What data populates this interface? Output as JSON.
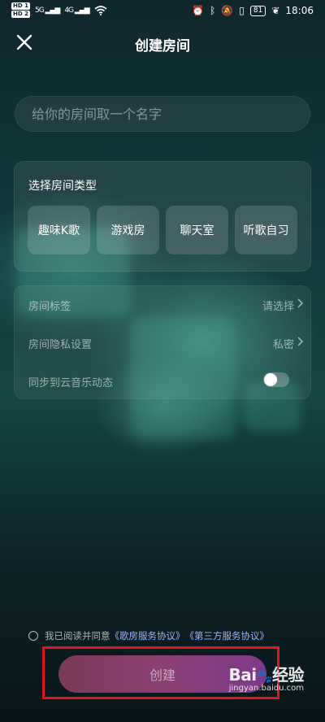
{
  "status_bar": {
    "hd1": "HD 1",
    "hd2": "HD 2",
    "sig1": "5G",
    "sig2": "4G",
    "battery": "81",
    "time": "18:06"
  },
  "header": {
    "title": "创建房间"
  },
  "name_input": {
    "placeholder": "给你的房间取一个名字",
    "value": ""
  },
  "room_type": {
    "title": "选择房间类型",
    "options": [
      "趣味K歌",
      "游戏房",
      "聊天室",
      "听歌自习"
    ]
  },
  "settings": {
    "tag_label": "房间标签",
    "tag_value": "请选择",
    "privacy_label": "房间隐私设置",
    "privacy_value": "私密",
    "sync_label": "同步到云音乐动态",
    "sync_on": false
  },
  "agreement": {
    "prefix": "我已阅读并同意",
    "link1": "《歌房服务协议》",
    "link2": "《第三方服务协议》"
  },
  "create_button": {
    "label": "创建"
  },
  "watermark": {
    "brand": "Bai",
    "brand_suffix": "经验",
    "url": "jingyan.baidu.com"
  },
  "colors": {
    "highlight": "#e0161d",
    "link": "#9fb3ff"
  }
}
